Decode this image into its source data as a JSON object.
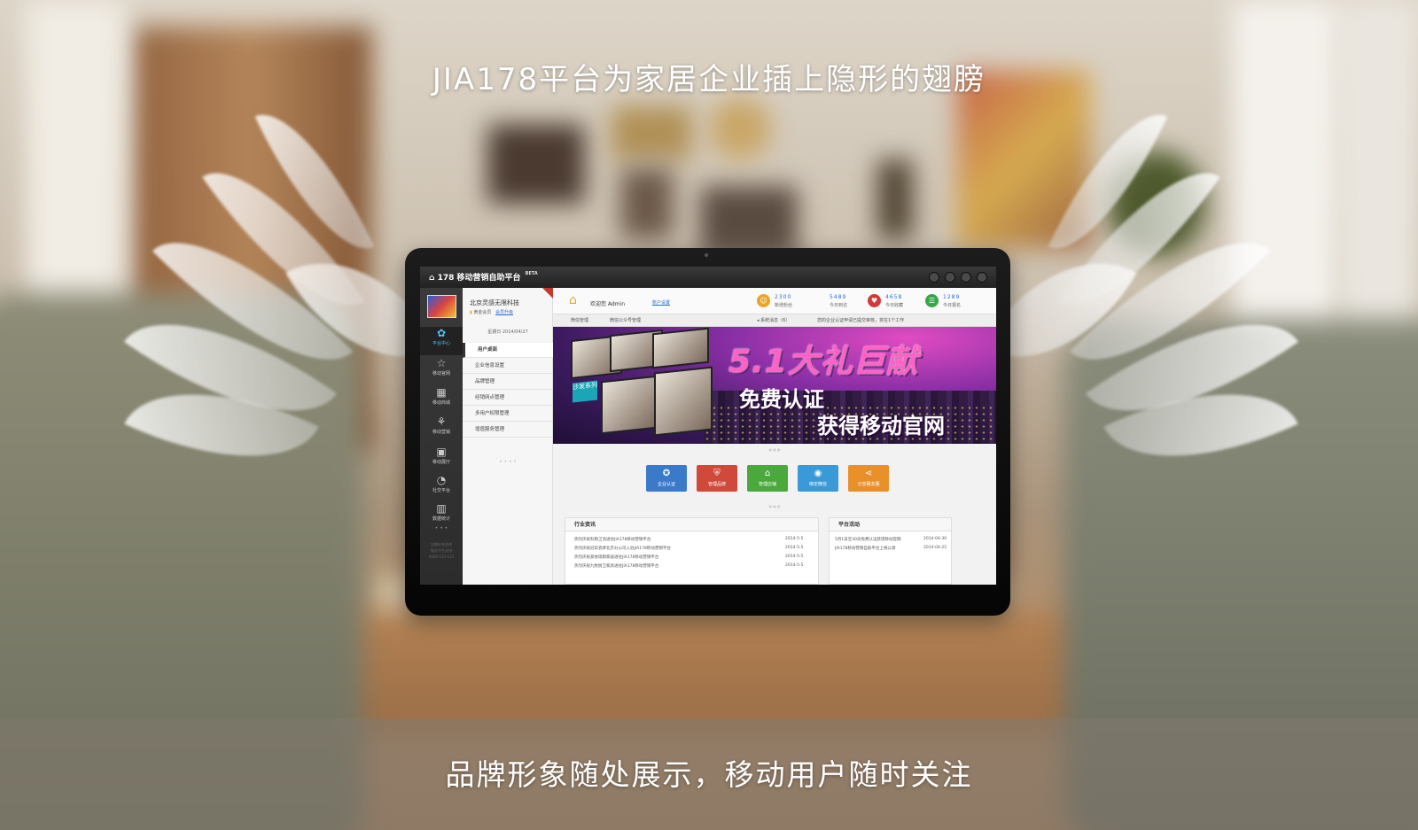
{
  "headline_top": "JIA178平台为家居企业插上隐形的翅膀",
  "headline_bottom": "品牌形象随处展示，移动用户随时关注",
  "app": {
    "logo_text": "178 移动营销自助平台",
    "beta": "BETA"
  },
  "icon_nav": [
    {
      "label": "平台中心",
      "icon": "flower-icon",
      "glyph": "✿"
    },
    {
      "label": "移动官网",
      "icon": "star-icon",
      "glyph": "☆"
    },
    {
      "label": "移动商城",
      "icon": "store-icon",
      "glyph": "▦"
    },
    {
      "label": "移动营销",
      "icon": "network-icon",
      "glyph": "⚘"
    },
    {
      "label": "移动展厅",
      "icon": "picture-icon",
      "glyph": "▣"
    },
    {
      "label": "社交平台",
      "icon": "chat-icon",
      "glyph": "◔"
    },
    {
      "label": "数据统计",
      "icon": "bar-chart-icon",
      "glyph": "▥"
    }
  ],
  "nav_more": "• • •",
  "nav_footer": [
    "店铺在线咨询",
    "服务平台支持",
    "4006-123-123"
  ],
  "company": {
    "name": "北京灵感无限科技",
    "member": "黄金会员",
    "upgrade": "会员升级",
    "date": "星期日 2014/04/27"
  },
  "menu": [
    "用户桌面",
    "企业信息设置",
    "品牌管理",
    "经销网点管理",
    "多用户权限管理",
    "增值服务管理"
  ],
  "menu_more": "• • • •",
  "header": {
    "welcome": "欢迎您 Admin",
    "account": "账户设置"
  },
  "stats": [
    {
      "value": "2300",
      "label": "新增粉丝",
      "icon": "fans-icon",
      "glyph": "☺",
      "color": "#e8a52a"
    },
    {
      "value": "5489",
      "label": "今日到访",
      "icon": "visit-icon",
      "glyph": "",
      "color": ""
    },
    {
      "value": "4658",
      "label": "今日收藏",
      "icon": "heart-icon",
      "glyph": "♥",
      "color": "#d23a3a"
    },
    {
      "value": "1289",
      "label": "今日报名",
      "icon": "signup-icon",
      "glyph": "☰",
      "color": "#3aa64a"
    }
  ],
  "breadcrumb": {
    "root": "微信管理",
    "current": "微信公众号管理",
    "notice_label": "系统消息（6）",
    "notice_text": "您的企业认证申请已提交审核，将在1个工作"
  },
  "banner": {
    "title": "5.1大礼巨献",
    "sub1": "免费认证",
    "sub2": "获得移动官网",
    "tag": "沙发系列"
  },
  "quick_actions": [
    {
      "label": "企业认证",
      "icon": "certify-icon",
      "glyph": "✪",
      "color": "#3a7ac8"
    },
    {
      "label": "管理品牌",
      "icon": "shield-icon",
      "glyph": "⛨",
      "color": "#d04a3c"
    },
    {
      "label": "管理店铺",
      "icon": "bank-icon",
      "glyph": "⌂",
      "color": "#4aa83c"
    },
    {
      "label": "绑定微信",
      "icon": "wechat-icon",
      "glyph": "◉",
      "color": "#3a9ad8"
    },
    {
      "label": "分享朋友圈",
      "icon": "share-icon",
      "glyph": "⋖",
      "color": "#e8902a"
    }
  ],
  "industry_news": {
    "title": "行业资讯",
    "items": [
      {
        "text": "热烈庆祝科勒卫浴进驻JIA178移动营销平台",
        "date": "2014-5-5"
      },
      {
        "text": "热烈庆祝冠军瓷砖北京分公司入驻JIA178移动营销平台",
        "date": "2014-5-5"
      },
      {
        "text": "热烈庆祝爱依瑞斯家居进驻JIA178移动营销平台",
        "date": "2014-5-5"
      },
      {
        "text": "热烈庆祝九牧厨卫家具进驻JIA178移动营销平台",
        "date": "2014-5-5"
      }
    ]
  },
  "platform_events": {
    "title": "平台活动",
    "items": [
      {
        "text": "5月1日至30日免费认证获得移动官网",
        "date": "2014-04-30"
      },
      {
        "text": "JIA178移动营销自助平台上线公测",
        "date": "2014-04-25"
      }
    ]
  },
  "colors": {
    "accent_blue": "#2a6fd4",
    "banner_pink": "#ff61c6"
  }
}
